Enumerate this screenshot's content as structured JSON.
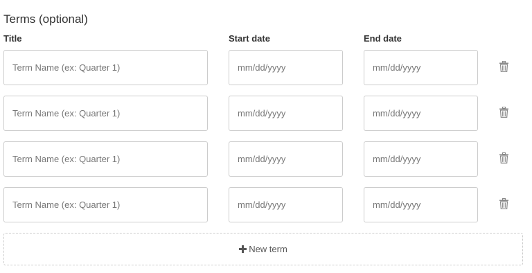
{
  "section": {
    "title": "Terms (optional)"
  },
  "columns": {
    "title": "Title",
    "start_date": "Start date",
    "end_date": "End date"
  },
  "terms": [
    {
      "title_value": "",
      "title_placeholder": "Term Name (ex: Quarter 1)",
      "start_value": "",
      "start_placeholder": "mm/dd/yyyy",
      "end_value": "",
      "end_placeholder": "mm/dd/yyyy"
    },
    {
      "title_value": "",
      "title_placeholder": "Term Name (ex: Quarter 1)",
      "start_value": "",
      "start_placeholder": "mm/dd/yyyy",
      "end_value": "",
      "end_placeholder": "mm/dd/yyyy"
    },
    {
      "title_value": "",
      "title_placeholder": "Term Name (ex: Quarter 1)",
      "start_value": "",
      "start_placeholder": "mm/dd/yyyy",
      "end_value": "",
      "end_placeholder": "mm/dd/yyyy"
    },
    {
      "title_value": "",
      "title_placeholder": "Term Name (ex: Quarter 1)",
      "start_value": "",
      "start_placeholder": "mm/dd/yyyy",
      "end_value": "",
      "end_placeholder": "mm/dd/yyyy"
    }
  ],
  "delete_icon": "trash-icon",
  "add_button": {
    "label": "New term",
    "icon": "plus-icon"
  },
  "colors": {
    "text": "#333333",
    "placeholder": "#777777",
    "border": "#cccccc",
    "icon": "#888888"
  }
}
